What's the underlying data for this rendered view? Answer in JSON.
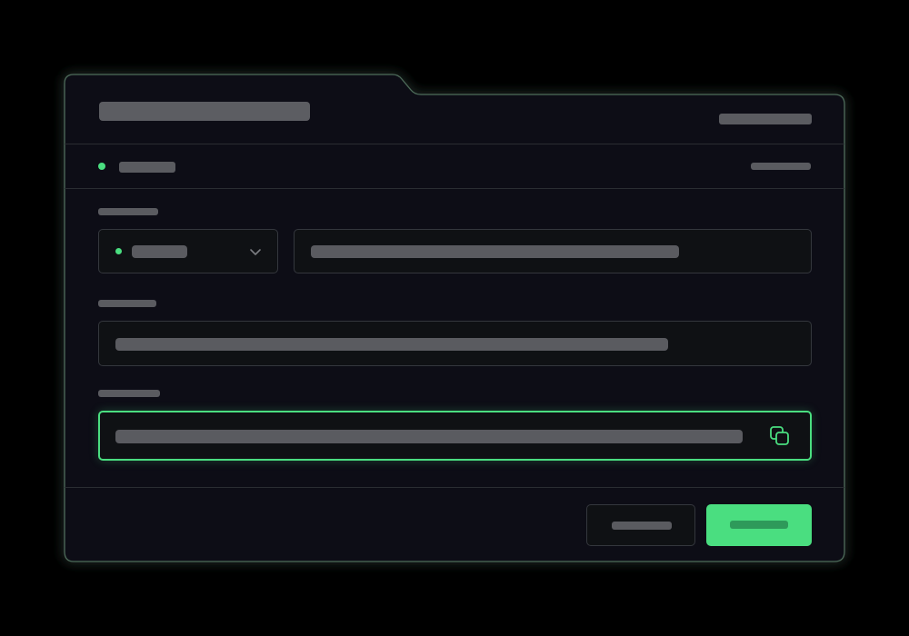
{
  "colors": {
    "background": "#000000",
    "panel": "#0f1114",
    "border": "#4a5a52",
    "accent": "#4ade80",
    "skeleton": "#5a5b60"
  },
  "header": {
    "title": "",
    "meta": ""
  },
  "status": {
    "indicator": "online",
    "label": "",
    "meta": ""
  },
  "form": {
    "fields": [
      {
        "label": "",
        "select_value": "",
        "select_status": "active",
        "input_value": ""
      },
      {
        "label": "",
        "input_value": ""
      },
      {
        "label": "",
        "input_value": "",
        "state": "focused",
        "action_icon": "copy-icon"
      }
    ]
  },
  "footer": {
    "cancel_label": "",
    "confirm_label": ""
  }
}
